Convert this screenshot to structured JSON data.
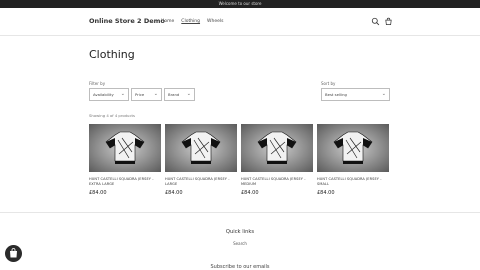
{
  "announcement": "Welcome to our store",
  "header": {
    "store_name": "Online Store 2 Demo",
    "nav": [
      {
        "label": "Home",
        "active": false
      },
      {
        "label": "Clothing",
        "active": true
      },
      {
        "label": "Wheels",
        "active": false
      }
    ],
    "icons": [
      "search-icon",
      "cart-icon"
    ]
  },
  "page": {
    "title": "Clothing"
  },
  "filters": {
    "label": "Filter by",
    "options": [
      "Availability",
      "Price",
      "Brand"
    ],
    "sort_label": "Sort by",
    "sort_value": "Best selling"
  },
  "product_count": "Showing 4 of 4 products",
  "products": [
    {
      "title": "HUNT CASTELLI SQUADRA JERSEY - EXTRA LARGE",
      "price": "£84.00"
    },
    {
      "title": "HUNT CASTELLI SQUADRA JERSEY - LARGE",
      "price": "£84.00"
    },
    {
      "title": "HUNT CASTELLI SQUADRA JERSEY - MEDIUM",
      "price": "£84.00"
    },
    {
      "title": "HUNT CASTELLI SQUADRA JERSEY - SMALL",
      "price": "£84.00"
    }
  ],
  "footer": {
    "quick_links_title": "Quick links",
    "quick_link": "Search",
    "subscribe": "Subscribe to our emails"
  },
  "colors": {
    "announcement_bg": "#222222",
    "text": "#222222",
    "border": "#e6e6e6"
  }
}
